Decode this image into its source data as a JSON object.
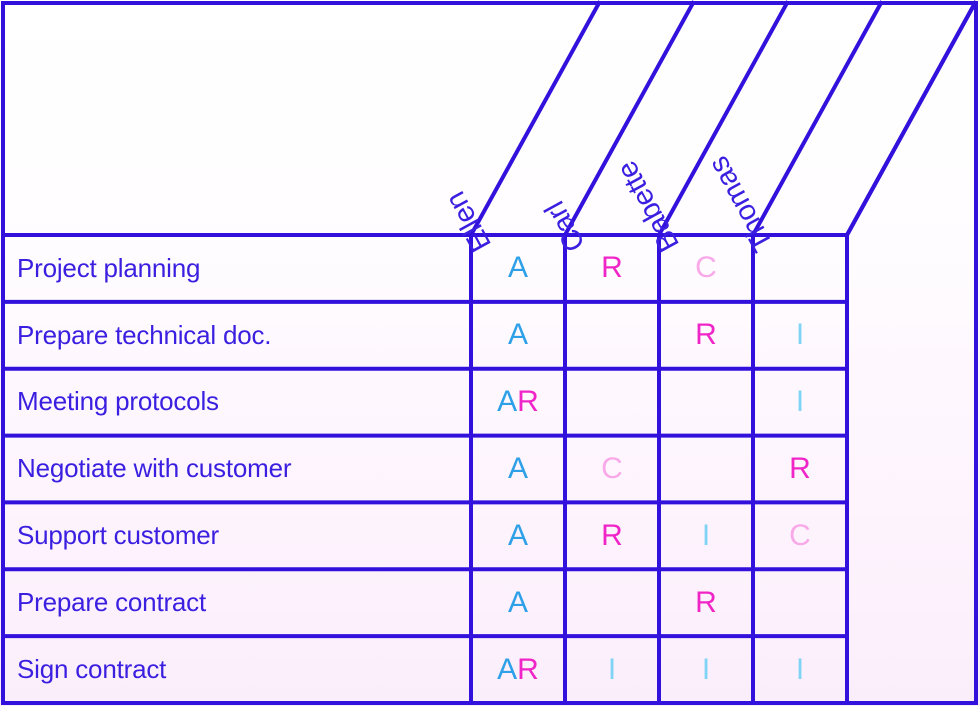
{
  "diagram": {
    "type": "raci-matrix",
    "colors": {
      "border": "#3311dd",
      "label_text": "#3a1fe0",
      "responsible_R": "#f025c8",
      "accountable_A": "#2da0e8",
      "consulted_C": "#f9a8e8",
      "informed_I": "#7fd4f5",
      "background_top": "#ffffff",
      "background_bottom": "#fbeefb"
    },
    "columns": [
      {
        "name": "Ellen"
      },
      {
        "name": "Carl"
      },
      {
        "name": "Babette"
      },
      {
        "name": "Thomas"
      }
    ],
    "rows": [
      {
        "task": "Project planning",
        "cells": [
          "A",
          "R",
          "C",
          ""
        ]
      },
      {
        "task": "Prepare technical doc.",
        "cells": [
          "A",
          "",
          "R",
          "I"
        ]
      },
      {
        "task": "Meeting protocols",
        "cells": [
          "AR",
          "",
          "",
          "I"
        ]
      },
      {
        "task": "Negotiate with customer",
        "cells": [
          "A",
          "C",
          "",
          "R"
        ]
      },
      {
        "task": "Support customer",
        "cells": [
          "A",
          "R",
          "I",
          "C"
        ]
      },
      {
        "task": "Prepare contract",
        "cells": [
          "A",
          "",
          "R",
          ""
        ]
      },
      {
        "task": "Sign contract",
        "cells": [
          "AR",
          "I",
          "I",
          "I"
        ]
      }
    ]
  }
}
